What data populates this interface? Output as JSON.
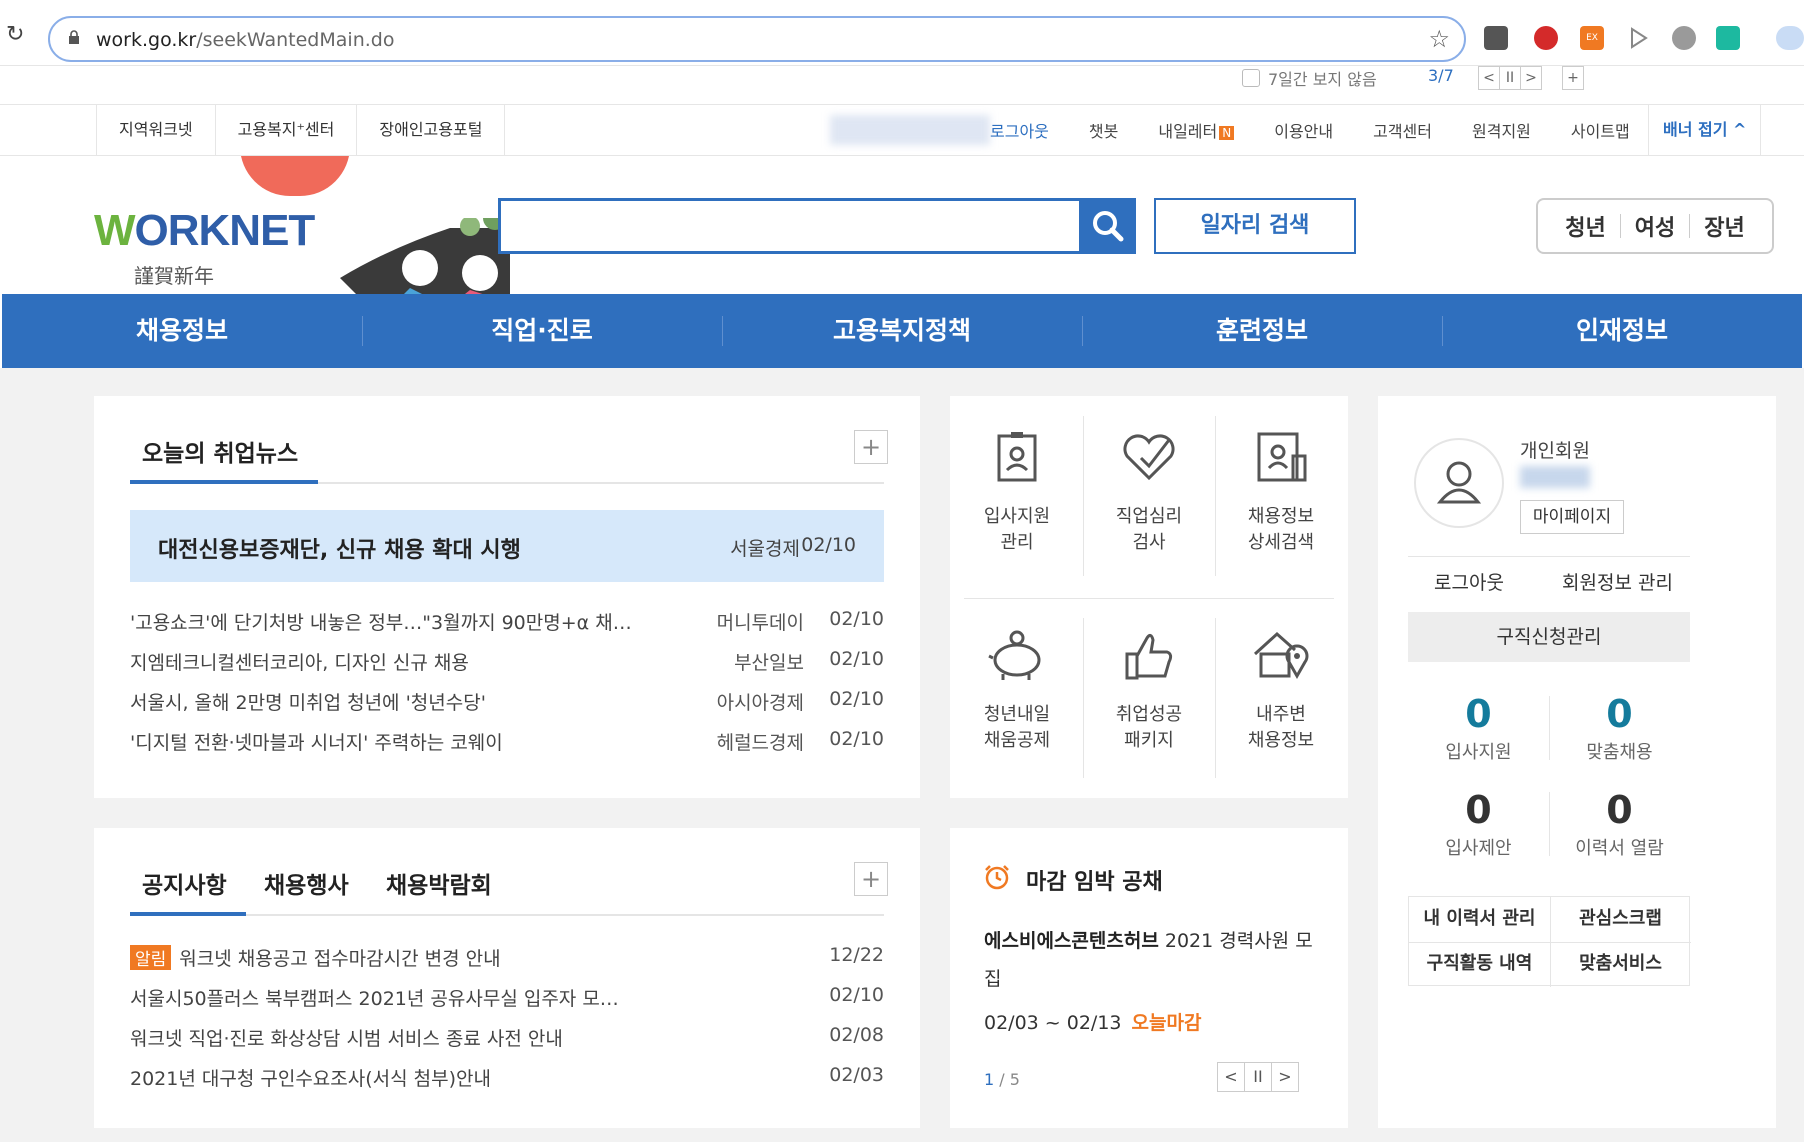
{
  "browser": {
    "url_host": "work.go.kr",
    "url_path": "/seekWantedMain.do"
  },
  "banner_control": {
    "hide_7days": "7일간 보지 않음",
    "page": "3/7",
    "prev": "<",
    "pause": "II",
    "next": ">",
    "plus": "+"
  },
  "util_left": [
    "지역워크넷",
    "고용복지⁺센터",
    "장애인고용포털"
  ],
  "util_right": {
    "logout": "로그아웃",
    "chatbot": "챗봇",
    "letter": "내일레터",
    "letter_badge": "N",
    "guide": "이용안내",
    "customer": "고객센터",
    "remote": "원격지원",
    "sitemap": "사이트맵",
    "banner_fold": "배너 접기 ^"
  },
  "logo": {
    "text_w": "W",
    "text_rest": "ORKNET",
    "greeting": "謹賀新年"
  },
  "search": {
    "button_label": "일자리 검색"
  },
  "target_buttons": [
    "청년",
    "여성",
    "장년"
  ],
  "gnb": [
    "채용정보",
    "직업·진로",
    "고용복지정책",
    "훈련정보",
    "인재정보"
  ],
  "news": {
    "title": "오늘의 취업뉴스",
    "plus": "+",
    "headline": {
      "title": "대전신용보증재단, 신규 채용 확대 시행",
      "source": "서울경제",
      "date": "02/10"
    },
    "items": [
      {
        "title": "'고용쇼크'에 단기처방 내놓은 정부…\"3월까지 90만명+α 채…",
        "source": "머니투데이",
        "date": "02/10"
      },
      {
        "title": "지엠테크니컬센터코리아, 디자인 신규 채용",
        "source": "부산일보",
        "date": "02/10"
      },
      {
        "title": "서울시, 올해 2만명 미취업 청년에 '청년수당'",
        "source": "아시아경제",
        "date": "02/10"
      },
      {
        "title": "'디지털 전환·넷마블과 시너지' 주력하는 코웨이",
        "source": "헤럴드경제",
        "date": "02/10"
      }
    ]
  },
  "notice": {
    "tabs": [
      "공지사항",
      "채용행사",
      "채용박람회"
    ],
    "plus": "+",
    "items": [
      {
        "badge": "알림",
        "title": "워크넷 채용공고 접수마감시간 변경 안내",
        "date": "12/22"
      },
      {
        "badge": "",
        "title": "서울시50플러스 북부캠퍼스 2021년 공유사무실 입주자 모…",
        "date": "02/10"
      },
      {
        "badge": "",
        "title": "워크넷 직업·진로 화상상담 시범 서비스 종료 사전 안내",
        "date": "02/08"
      },
      {
        "badge": "",
        "title": "2021년 대구청 구인수요조사(서식 첨부)안내",
        "date": "02/03"
      }
    ]
  },
  "quick_menu": [
    {
      "icon": "applicant-management-icon",
      "label": "입사지원\n관리"
    },
    {
      "icon": "aptitude-test-icon",
      "label": "직업심리\n검사"
    },
    {
      "icon": "detailed-search-icon",
      "label": "채용정보\n상세검색"
    },
    {
      "icon": "piggy-bank-icon",
      "label": "청년내일\n채움공제"
    },
    {
      "icon": "thumbs-up-icon",
      "label": "취업성공\n패키지"
    },
    {
      "icon": "house-location-icon",
      "label": "내주변\n채용정보"
    }
  ],
  "deadline": {
    "title": "마감 임박 공채",
    "company": "에스비에스콘텐츠허브",
    "desc": " 2021 경력사원 모집",
    "date": "02/03 ~ 02/13",
    "urgent": "오늘마감",
    "page_current": "1",
    "page_total": " / 5",
    "prev": "<",
    "pause": "II",
    "next": ">"
  },
  "member": {
    "type": "개인회원",
    "mypage": "마이페이지",
    "logout": "로그아웃",
    "info": "회원정보 관리",
    "apply_mgmt": "구직신청관리",
    "stats": [
      {
        "value": "0",
        "label": "입사지원"
      },
      {
        "value": "0",
        "label": "맞춤채용"
      },
      {
        "value": "0",
        "label": "입사제안"
      },
      {
        "value": "0",
        "label": "이력서 열람"
      }
    ],
    "links": [
      "내 이력서 관리",
      "관심스크랩",
      "구직활동 내역",
      "맞춤서비스"
    ]
  },
  "colors": {
    "primary_blue": "#2f6fbe",
    "accent_orange": "#f07922",
    "stat_teal": "#147b9c",
    "headline_bg": "#d6e8fa"
  }
}
